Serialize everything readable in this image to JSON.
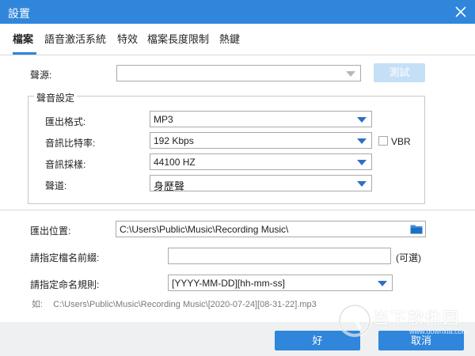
{
  "window": {
    "title": "設置"
  },
  "tabs": [
    {
      "label": "檔案"
    },
    {
      "label": "語音激活系統"
    },
    {
      "label": "特效"
    },
    {
      "label": "檔案長度限制"
    },
    {
      "label": "熱鍵"
    }
  ],
  "source": {
    "label": "聲源:",
    "value": "",
    "test_button": "測試"
  },
  "sound_settings": {
    "title": "聲音設定",
    "format": {
      "label": "匯出格式:",
      "value": "MP3"
    },
    "bitrate": {
      "label": "音訊比特率:",
      "value": "192 Kbps",
      "vbr_label": "VBR",
      "vbr_checked": false
    },
    "samplerate": {
      "label": "音訊採樣:",
      "value": "44100 HZ"
    },
    "channel": {
      "label": "聲道:",
      "value": "身歷聲"
    }
  },
  "output": {
    "location_label": "匯出位置:",
    "location_value": "C:\\Users\\Public\\Music\\Recording Music\\",
    "prefix_label": "請指定檔名前綴:",
    "prefix_value": "",
    "optional_label": "(可選)",
    "naming_label": "請指定命名規則:",
    "naming_value": "[YYYY-MM-DD][hh-mm-ss]",
    "example_prefix": "如:",
    "example_path": "C:\\Users\\Public\\Music\\Recording Music\\[2020-07-24][08-31-22].mp3"
  },
  "buttons": {
    "ok": "好",
    "cancel": "取消"
  },
  "watermark": {
    "text": "当下软件园",
    "url": "www.downxia.com"
  },
  "colors": {
    "accent": "#2f86db",
    "caret": "#2f6fc4",
    "disabled_button": "#c5dff7",
    "footer_bg": "#eef0f2"
  }
}
